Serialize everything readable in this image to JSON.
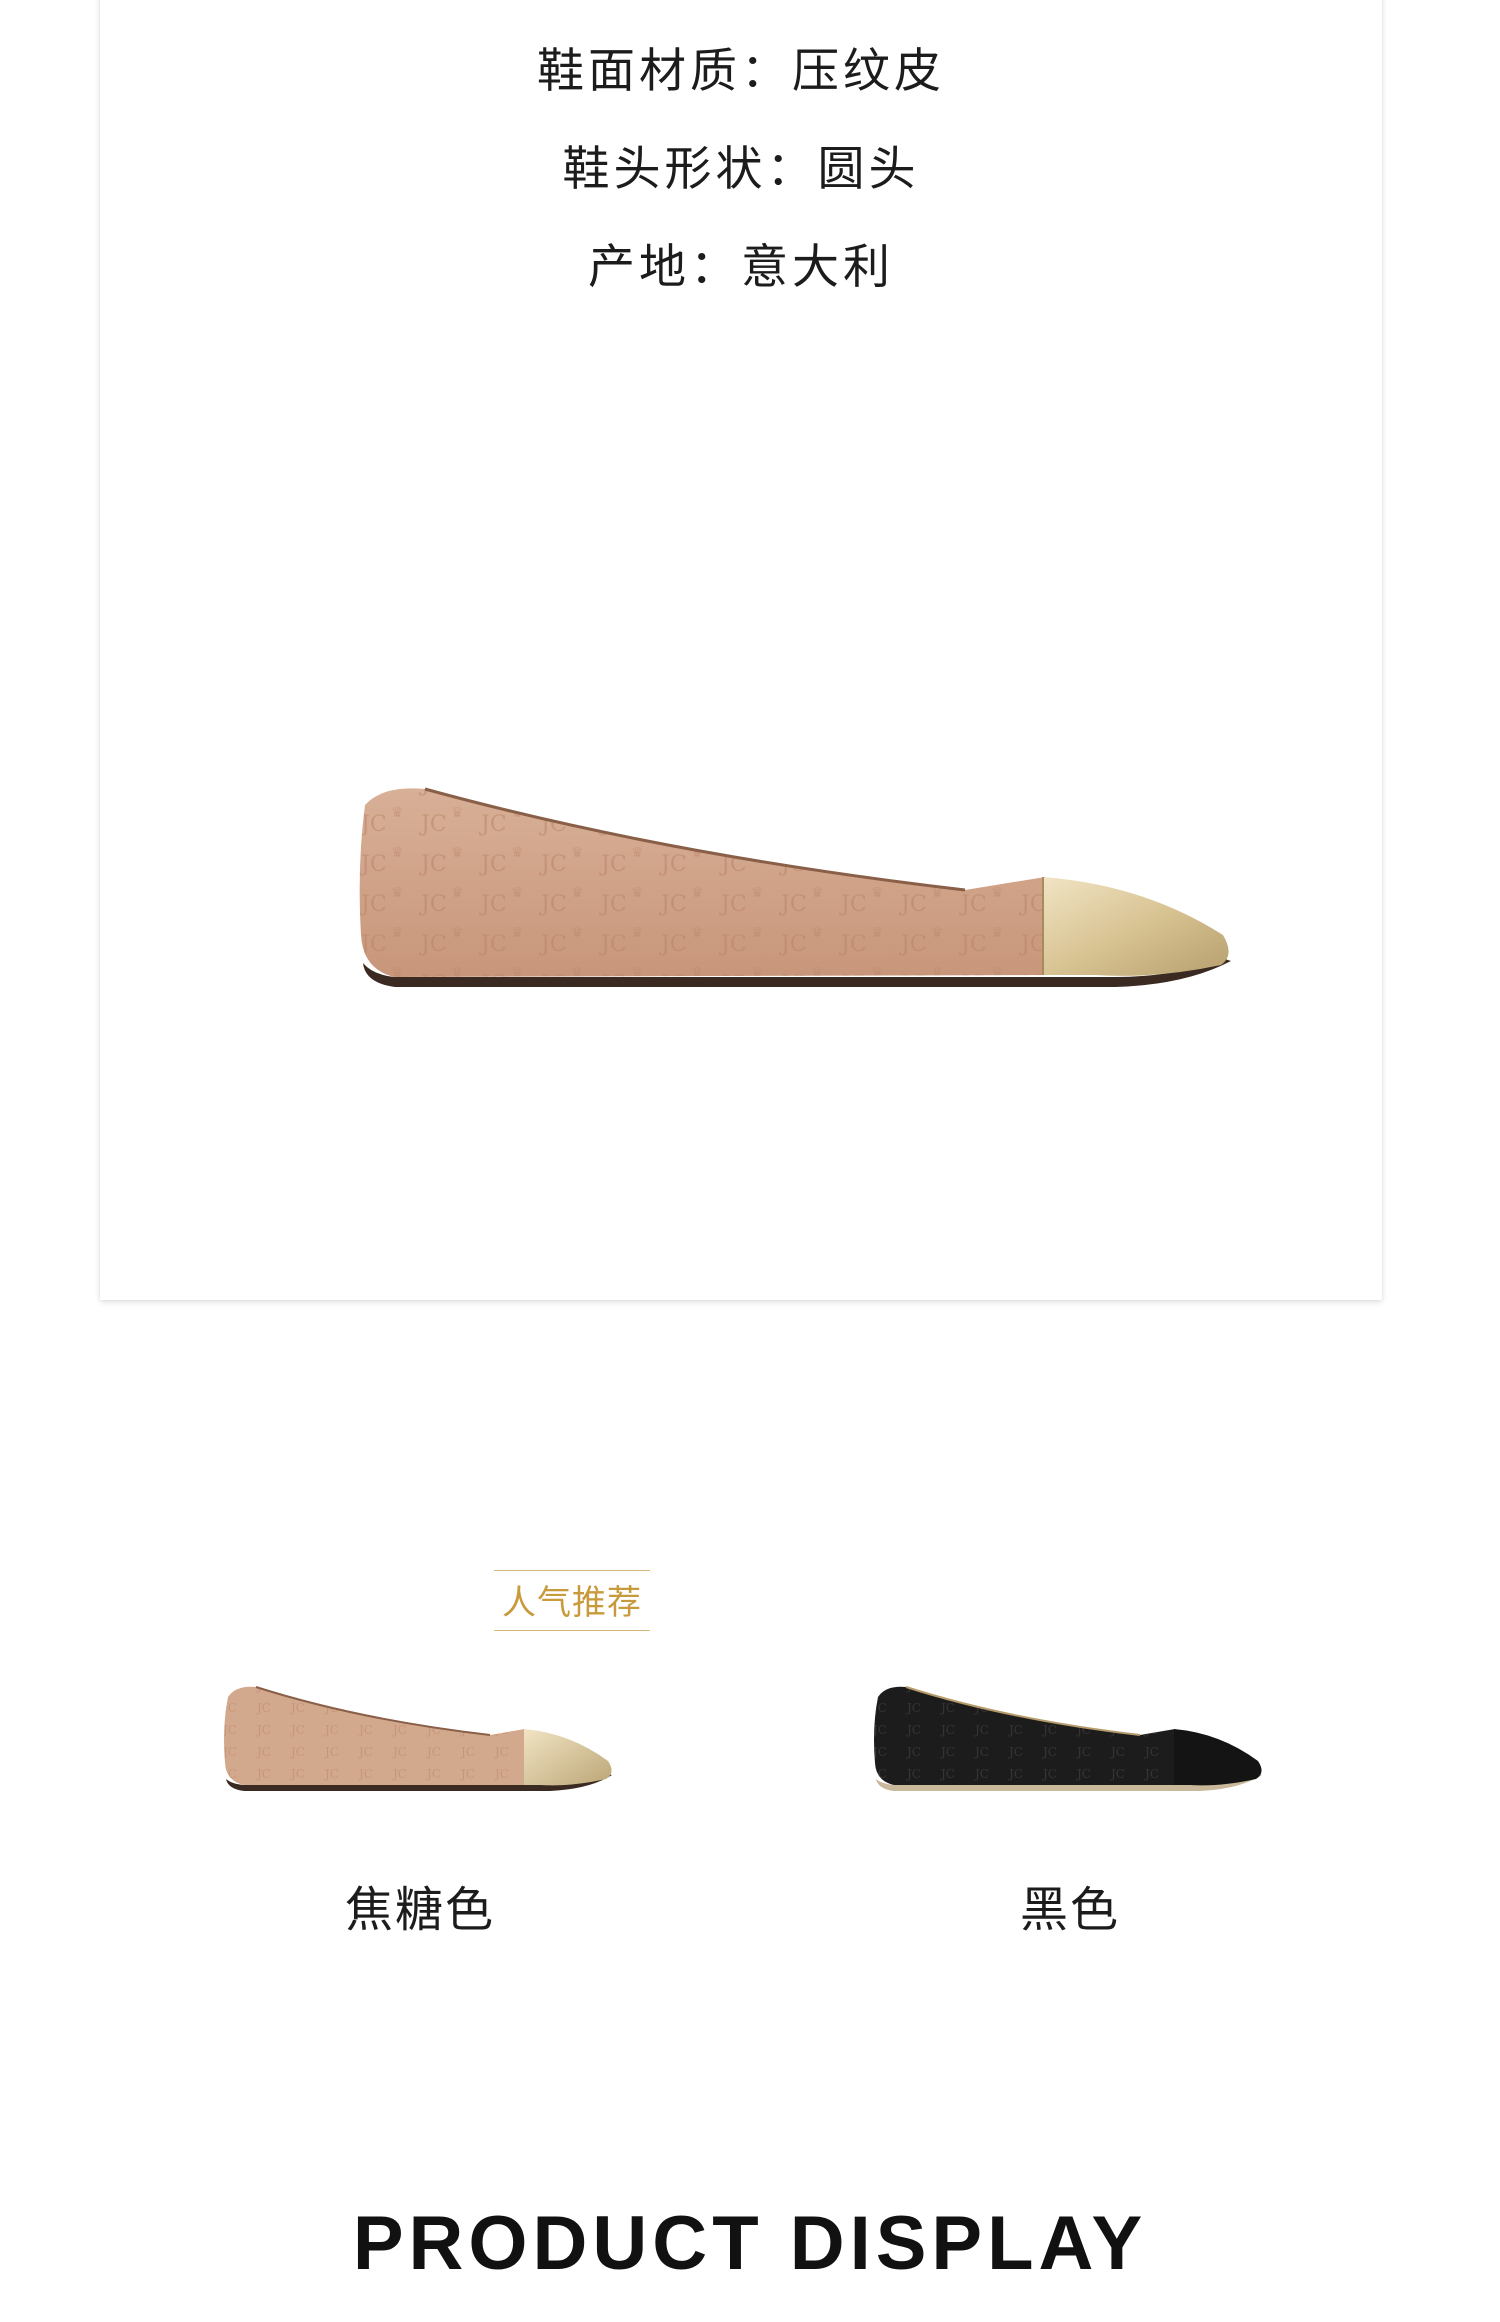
{
  "specs": {
    "upper_material": "鞋面材质：压纹皮",
    "toe_shape": "鞋头形状：圆头",
    "origin": "产地：意大利"
  },
  "recommendation": {
    "badge_label": "人气推荐"
  },
  "variants": [
    {
      "color_name": "焦糖色",
      "swatch": "#d2a88c",
      "toe_cap": "#d9c7a0"
    },
    {
      "color_name": "黑色",
      "swatch": "#1c1c1c",
      "toe_cap": "#141414"
    }
  ],
  "section": {
    "title": "PRODUCT DISPLAY"
  },
  "colors": {
    "accent_gold": "#c89a3c",
    "caramel": "#d2a88c",
    "black": "#1c1c1c"
  }
}
